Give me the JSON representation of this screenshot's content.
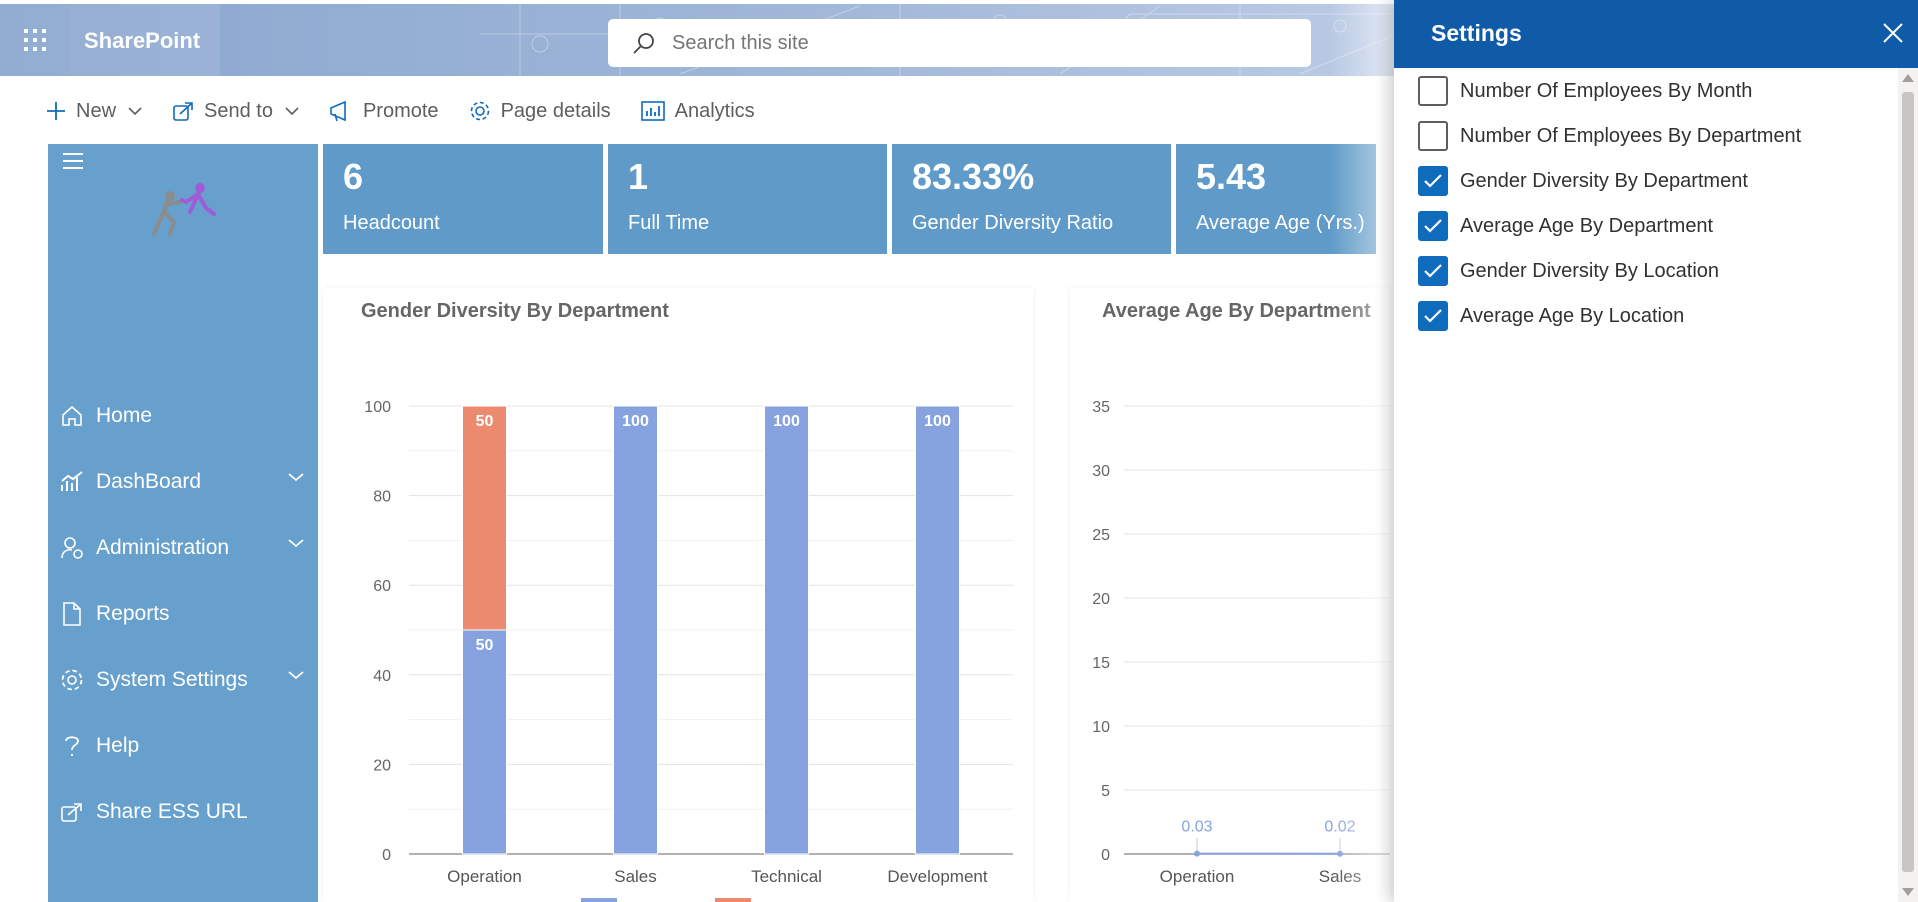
{
  "suite": {
    "app_name": "SharePoint",
    "search_placeholder": "Search this site"
  },
  "commands": [
    {
      "label": "New",
      "icon": "plus-icon",
      "has_menu": true
    },
    {
      "label": "Send to",
      "icon": "share-icon",
      "has_menu": true
    },
    {
      "label": "Promote",
      "icon": "megaphone-icon",
      "has_menu": false
    },
    {
      "label": "Page details",
      "icon": "gear-icon",
      "has_menu": false
    },
    {
      "label": "Analytics",
      "icon": "analytics-icon",
      "has_menu": false
    }
  ],
  "sidebar": {
    "items": [
      {
        "label": "Home",
        "icon": "home-icon",
        "expandable": false
      },
      {
        "label": "DashBoard",
        "icon": "dashboard-chart-icon",
        "expandable": true
      },
      {
        "label": "Administration",
        "icon": "admin-user-gear-icon",
        "expandable": true
      },
      {
        "label": "Reports",
        "icon": "document-icon",
        "expandable": false
      },
      {
        "label": "System Settings",
        "icon": "gear-icon",
        "expandable": true
      },
      {
        "label": "Help",
        "icon": "question-icon",
        "expandable": false
      },
      {
        "label": "Share ESS URL",
        "icon": "share-link-icon",
        "expandable": false
      }
    ]
  },
  "kpis": [
    {
      "value": "6",
      "label": "Headcount"
    },
    {
      "value": "1",
      "label": "Full Time"
    },
    {
      "value": "83.33%",
      "label": "Gender Diversity Ratio"
    },
    {
      "value": "5.43",
      "label": "Average Age (Yrs.)"
    }
  ],
  "chart_data": [
    {
      "type": "bar",
      "stacked": true,
      "title": "Gender Diversity By Department",
      "categories": [
        "Operation",
        "Sales",
        "Technical",
        "Development"
      ],
      "series": [
        {
          "name": "",
          "color": "#86a3e0",
          "values": [
            50,
            100,
            100,
            100
          ]
        },
        {
          "name": "",
          "color": "#ec8a70",
          "values": [
            50,
            0,
            0,
            0
          ]
        }
      ],
      "ylim": [
        0,
        100
      ],
      "yticks": [
        0,
        20,
        40,
        60,
        80,
        100
      ],
      "grid": true,
      "legend": "bottom"
    },
    {
      "type": "line",
      "title": "Average Age By Department",
      "categories": [
        "Operation",
        "Sales"
      ],
      "values": [
        0.03,
        0.02
      ],
      "color": "#86a3e0",
      "ylim": [
        0,
        35
      ],
      "yticks": [
        0,
        5,
        10,
        15,
        20,
        25,
        30,
        35
      ],
      "grid": true
    }
  ],
  "settings_panel": {
    "title": "Settings",
    "options": [
      {
        "label": "Number Of Employees By Month",
        "checked": false
      },
      {
        "label": "Number Of Employees By Department",
        "checked": false
      },
      {
        "label": "Gender Diversity By Department",
        "checked": true
      },
      {
        "label": "Average Age By Department",
        "checked": true
      },
      {
        "label": "Gender Diversity By Location",
        "checked": true
      },
      {
        "label": "Average Age By Location",
        "checked": true
      }
    ]
  },
  "colors": {
    "sidebar": "#67a0cc",
    "tile": "#5f9ac8",
    "panel_header": "#0f5ba7",
    "checkbox_on": "#0f6cbd"
  }
}
